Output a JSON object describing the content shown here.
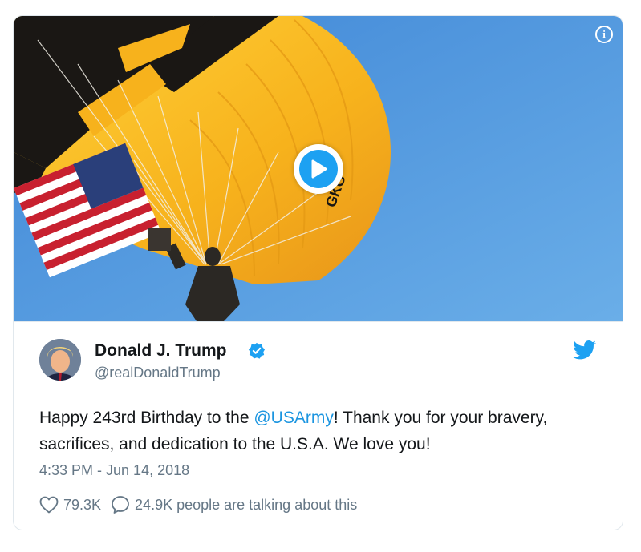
{
  "tweet": {
    "author_name": "Donald J. Trump",
    "handle": "@realDonaldTrump",
    "text_before": "Happy 243rd Birthday to the ",
    "mention": "@USArmy",
    "text_after": "! Thank you for your bravery, sacrifices, and dedication to the U.S.A. We love you!",
    "timestamp": "4:33 PM - Jun 14, 2018",
    "likes": "79.3K",
    "replies_text": "24.9K people are talking about this"
  },
  "media": {
    "info_label": "i",
    "canopy_text": "GKG"
  },
  "colors": {
    "accent": "#1da1f2",
    "mention": "#1b95e0",
    "muted": "#657786",
    "sky": "#4f97de",
    "canopy_gold": "#f7b21c"
  },
  "icons": {
    "info": "info-icon",
    "play": "play-icon",
    "verified": "verified-badge-icon",
    "twitter": "twitter-bird-icon",
    "like": "heart-icon",
    "reply": "speech-bubble-icon"
  }
}
